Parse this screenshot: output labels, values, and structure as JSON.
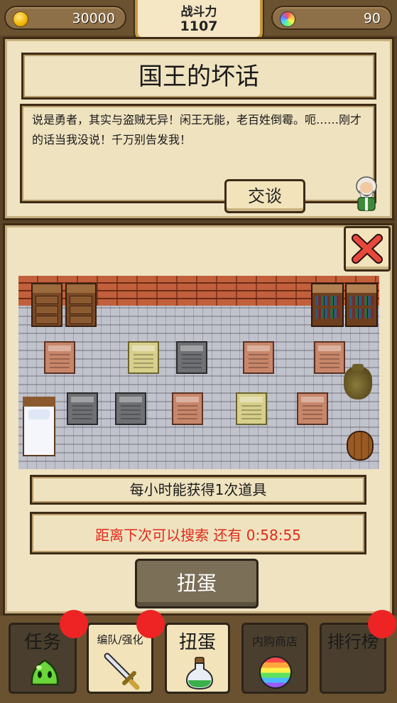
{
  "currency": {
    "gold": "30000",
    "gems": "90"
  },
  "combat_power": {
    "label": "战斗力",
    "value": "1107"
  },
  "event": {
    "title": "国王的坏话",
    "dialog": "说是勇者，其实与盗贼无异！闲王无能，老百姓倒霉。呃……刚才的话当我没说！千万别告发我！",
    "talk_button": "交谈"
  },
  "room": {
    "info": "每小时能获得1次道具",
    "countdown": "距离下次可以搜索 还有 0:58:55",
    "gacha_button": "扭蛋"
  },
  "colors": {
    "countdown_text": "#e02a1a",
    "notification_dot": "#ee2424",
    "panel_bg": "#f0e3c2"
  },
  "nav": {
    "tabs": [
      {
        "label": "任务",
        "icon": "slime-icon",
        "active": false,
        "badge": true
      },
      {
        "label": "编队/强化",
        "icon": "sword-icon",
        "active": true,
        "badge": true
      },
      {
        "label": "扭蛋",
        "icon": "potion-icon",
        "active": true,
        "badge": false
      },
      {
        "label": "内购商店",
        "icon": "rainbow-gem-icon",
        "active": false,
        "badge": false
      },
      {
        "label": "排行榜",
        "icon": "",
        "active": false,
        "badge": true
      }
    ]
  }
}
